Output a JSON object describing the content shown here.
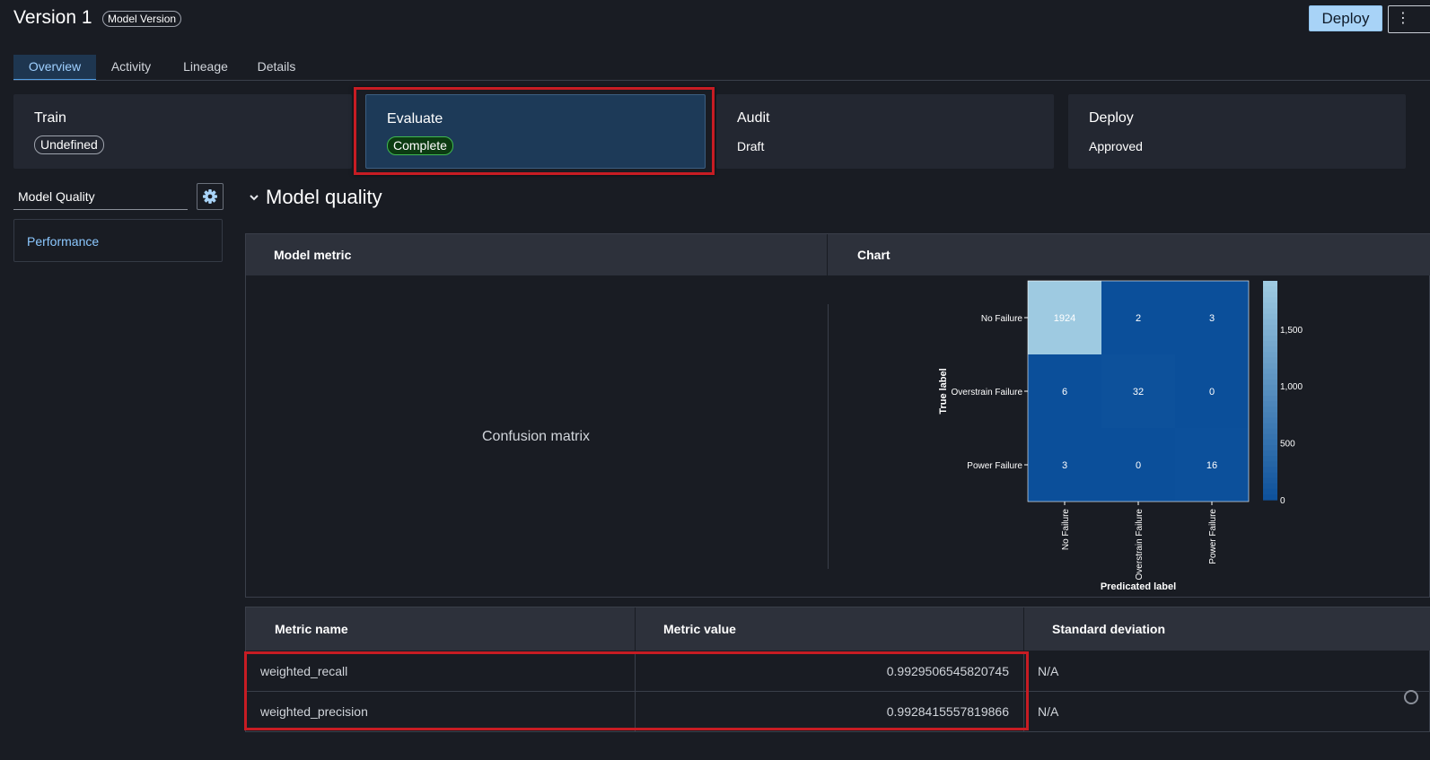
{
  "header": {
    "title": "Version 1",
    "badge": "Model Version",
    "deploy_label": "Deploy",
    "more_icon": "vertical-ellipsis-icon"
  },
  "tabs": [
    {
      "label": "Overview",
      "active": true
    },
    {
      "label": "Activity",
      "active": false
    },
    {
      "label": "Lineage",
      "active": false
    },
    {
      "label": "Details",
      "active": false
    }
  ],
  "stages": [
    {
      "title": "Train",
      "status": "Undefined",
      "style": "pill-grey"
    },
    {
      "title": "Evaluate",
      "status": "Complete",
      "style": "pill-green",
      "highlighted": true
    },
    {
      "title": "Audit",
      "status": "Draft",
      "style": "plain"
    },
    {
      "title": "Deploy",
      "status": "Approved",
      "style": "plain"
    }
  ],
  "sidebar": {
    "filter_value": "Model Quality",
    "settings_icon": "gear-icon",
    "items": [
      {
        "label": "Performance"
      }
    ]
  },
  "section": {
    "title": "Model quality",
    "chevron_icon": "chevron-down-icon"
  },
  "matrix_table": {
    "col_metric": "Model metric",
    "col_chart": "Chart",
    "metric_name": "Confusion matrix"
  },
  "chart_data": {
    "type": "heatmap",
    "title": "",
    "xlabel": "Predicated label",
    "ylabel": "True label",
    "x_categories": [
      "No Failure",
      "Overstrain Failure",
      "Power Failure"
    ],
    "y_categories": [
      "No Failure",
      "Overstrain Failure",
      "Power Failure"
    ],
    "values": [
      [
        1924,
        2,
        3
      ],
      [
        6,
        32,
        0
      ],
      [
        3,
        0,
        16
      ]
    ],
    "colorbar": {
      "ticks": [
        "0",
        "500",
        "1,000",
        "1,500"
      ],
      "range": [
        0,
        1924
      ]
    },
    "colors": {
      "low": "#0b4f9a",
      "high": "#9ecae1",
      "text": "#ffffff"
    }
  },
  "metrics_table": {
    "headers": [
      "Metric name",
      "Metric value",
      "Standard deviation"
    ],
    "rows": [
      {
        "name": "weighted_recall",
        "value": "0.9929506545820745",
        "std": "N/A"
      },
      {
        "name": "weighted_precision",
        "value": "0.9928415557819866",
        "std": "N/A"
      }
    ]
  },
  "colors": {
    "background": "#191c23",
    "accent": "#539fe5",
    "highlight": "#c71c23",
    "complete": "#3fb950"
  }
}
